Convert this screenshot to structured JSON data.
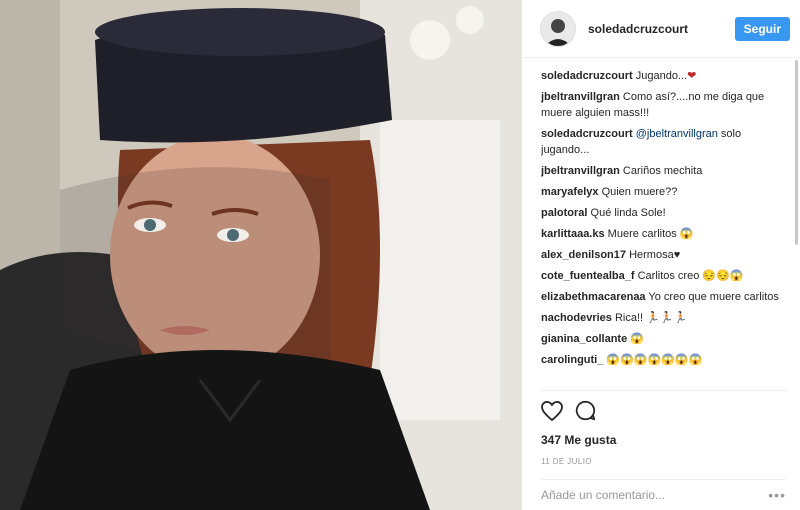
{
  "post": {
    "username": "soledadcruzcourt",
    "follow_label": "Seguir",
    "likes": "347 Me gusta",
    "date": "11 DE JULIO",
    "comment_placeholder": "Añade un comentario...",
    "more_label": "•••"
  },
  "comments": [
    {
      "user": "soledadcruzcourt",
      "text": "Jugando...",
      "emoji": "❤"
    },
    {
      "user": "jbeltranvillgran",
      "text": "Como así?....no me diga que muere alguien mass!!!"
    },
    {
      "user": "soledadcruzcourt",
      "mention": "@jbeltranvillgran",
      "text": "solo jugando..."
    },
    {
      "user": "jbeltranvillgran",
      "text": "Cariños mechita"
    },
    {
      "user": "maryafelyx",
      "text": "Quien muere??"
    },
    {
      "user": "palotoral",
      "text": "Qué linda Sole!"
    },
    {
      "user": "karlittaaa.ks",
      "text": "Muere carlitos",
      "emoji": "😱"
    },
    {
      "user": "alex_denilson17",
      "text": "Hermosa",
      "emoji": "♥"
    },
    {
      "user": "cote_fuentealba_f",
      "text": "Carlitos creo",
      "emoji": "😔😔😱"
    },
    {
      "user": "elizabethmacarenaa",
      "text": "Yo creo que muere carlitos"
    },
    {
      "user": "nachodevries",
      "text": "Rica!!",
      "emoji": "🏃🏻🏃🏻🏃🏻"
    },
    {
      "user": "gianina_collante",
      "text": "",
      "emoji": "😱"
    },
    {
      "user": "carolinguti_",
      "text": "",
      "emoji": "😱😱😱😱😱😱😱"
    }
  ],
  "icons": {
    "like": "heart-icon",
    "comment": "comment-icon"
  },
  "colors": {
    "follow_button": "#3897f0",
    "mention": "#003569",
    "heart_emoji": "#c0282d"
  }
}
